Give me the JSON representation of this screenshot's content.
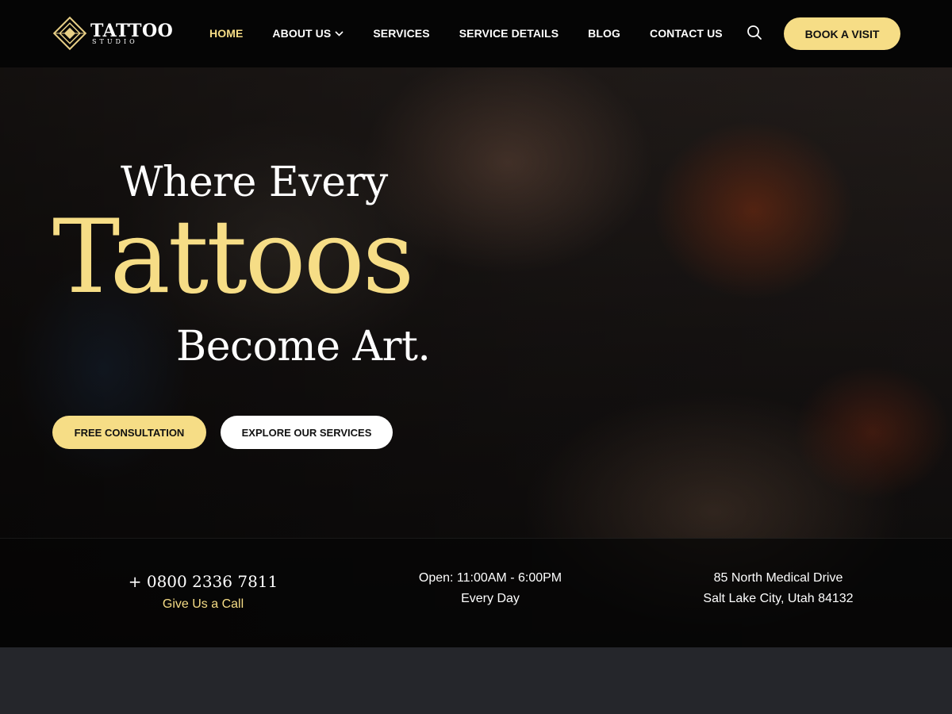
{
  "header": {
    "logo": {
      "title": "TATTOO",
      "subtitle": "STUDIO"
    },
    "nav": [
      {
        "label": "HOME",
        "active": true
      },
      {
        "label": "ABOUT US",
        "has_dropdown": true
      },
      {
        "label": "SERVICES"
      },
      {
        "label": "SERVICE DETAILS"
      },
      {
        "label": "BLOG"
      },
      {
        "label": "CONTACT US"
      }
    ],
    "search_icon": "search-icon",
    "book_button": "BOOK A VISIT"
  },
  "hero": {
    "line1": "Where Every",
    "line2": "Tattoos",
    "line3": "Become Art.",
    "cta_primary": "FREE CONSULTATION",
    "cta_secondary": "EXPLORE OUR SERVICES"
  },
  "info": {
    "phone": "+ 0800 2336 7811",
    "phone_link": "Give Us a Call",
    "hours_line1": "Open: 11:00AM - 6:00PM",
    "hours_line2": "Every Day",
    "address_line1": "85 North Medical Drive",
    "address_line2": "Salt Lake City, Utah 84132"
  },
  "colors": {
    "accent": "#f6dd86",
    "header_bg": "#050505",
    "footer_bg": "#25262b"
  }
}
